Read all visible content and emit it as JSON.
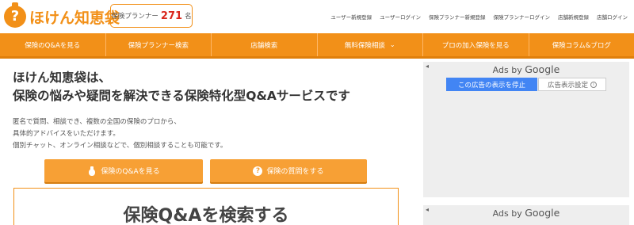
{
  "header": {
    "logo_text": "ほけん知恵袋",
    "counter": {
      "label": "保険プランナー",
      "count": "271",
      "unit": "名"
    },
    "links": [
      "ユーザー新規登録",
      "ユーザーログイン",
      "保険プランナー新規登録",
      "保険プランナーログイン",
      "店舗新規登録",
      "店舗ログイン"
    ]
  },
  "nav": {
    "items": [
      "保険のQ&Aを見る",
      "保険プランナー検索",
      "店舗検索",
      "無料保険相談",
      "プロの加入保険を見る",
      "保険コラム&ブログ"
    ]
  },
  "main": {
    "headline_1": "ほけん知恵袋は、",
    "headline_2": "保険の悩みや疑問を解決できる保険特化型Q&Aサービスです",
    "desc_1": "匿名で質問、相談でき、複数の全国の保険のプロから、",
    "desc_2": "具体的アドバイスをいただけます。",
    "desc_3": "個別チャット、オンライン相談などで、個別相談することも可能です。",
    "cta_left": "保険のQ&Aを見る",
    "cta_right": "保険の質問をする",
    "search_title": "保険Q&Aを検索する"
  },
  "ads": {
    "ads_by": "Ads by",
    "google": "Google",
    "stop_label": "この広告の表示を停止",
    "settings_label": "広告表示設定",
    "arrow": "◂"
  },
  "colors": {
    "accent": "#f29018",
    "ad_button": "#4285f4",
    "counter_number": "#d9261c"
  }
}
